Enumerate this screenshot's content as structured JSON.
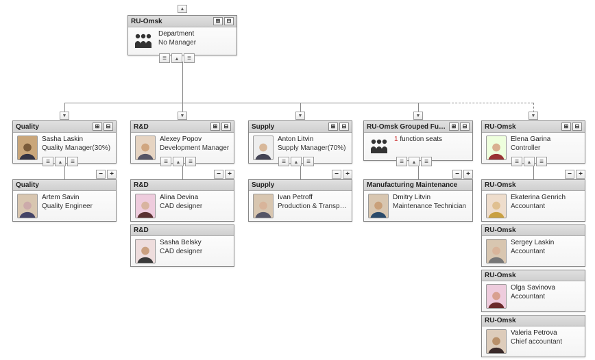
{
  "root": {
    "title": "RU-Omsk",
    "name": "Department",
    "role": "No Manager"
  },
  "branches": [
    {
      "title": "Quality",
      "name": "Sasha Laskin",
      "role": "Quality Manager(30%)",
      "children": [
        {
          "title": "Quality",
          "name": "Artem Savin",
          "role": "Quality Engineer"
        }
      ]
    },
    {
      "title": "R&D",
      "name": "Alexey Popov",
      "role": "Development Manager",
      "children": [
        {
          "title": "R&D",
          "name": "Alina Devina",
          "role": "CAD designer"
        },
        {
          "title": "R&D",
          "name": "Sasha Belsky",
          "role": "CAD designer"
        }
      ]
    },
    {
      "title": "Supply",
      "name": "Anton Litvin",
      "role": "Supply Manager(70%)",
      "children": [
        {
          "title": "Supply",
          "name": "Ivan Petroff",
          "role": "Production & Transport Plann..."
        }
      ]
    },
    {
      "title": "RU-Omsk Grouped Functions",
      "seats_label": "function seats",
      "seats_count": "1",
      "is_group": true,
      "children": [
        {
          "title": "Manufacturing Maintenance",
          "name": "Dmitry Litvin",
          "role": "Maintenance Technician"
        }
      ]
    },
    {
      "title": "RU-Omsk",
      "name": "Elena Garina",
      "role": "Controller",
      "dashed": true,
      "children": [
        {
          "title": "RU-Omsk",
          "name": "Ekaterina Genrich",
          "role": "Accountant"
        },
        {
          "title": "RU-Omsk",
          "name": "Sergey Laskin",
          "role": "Accountant"
        },
        {
          "title": "RU-Omsk",
          "name": "Olga Savinova",
          "role": "Accountant"
        },
        {
          "title": "RU-Omsk",
          "name": "Valeria Petrova",
          "role": "Chief accountant"
        }
      ]
    }
  ],
  "glyphs": {
    "minus": "−",
    "plus": "+",
    "down": "▼",
    "up": "▲"
  }
}
